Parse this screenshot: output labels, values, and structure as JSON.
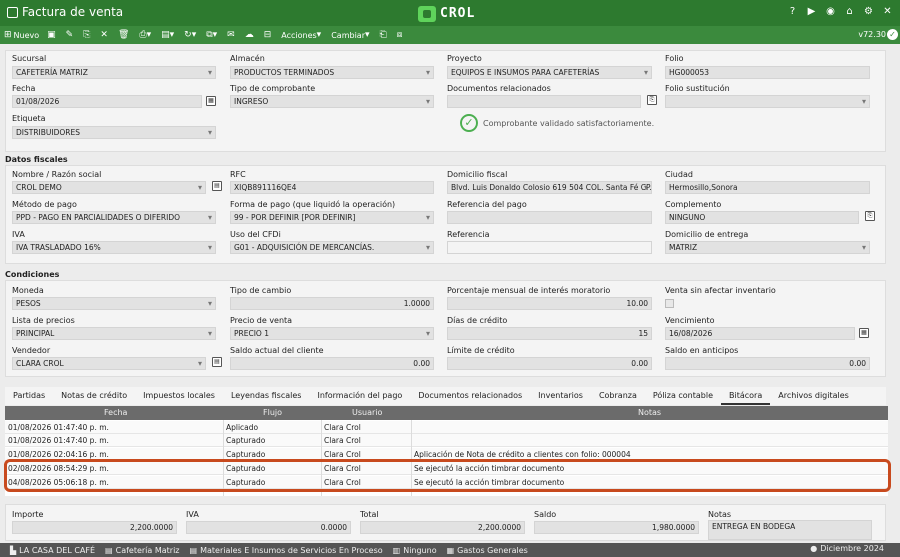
{
  "window": {
    "title": "Factura de venta",
    "logo_text": "CROL"
  },
  "toolbar": {
    "nuevo": "Nuevo",
    "acciones": "Acciones",
    "cambiar": "Cambiar",
    "version": "v72.30"
  },
  "general": {
    "sucursal": {
      "label": "Sucursal",
      "value": "CAFETERÍA MATRIZ"
    },
    "almacen": {
      "label": "Almacén",
      "value": "PRODUCTOS TERMINADOS"
    },
    "proyecto": {
      "label": "Proyecto",
      "value": "EQUIPOS E INSUMOS PARA CAFETERÍAS"
    },
    "folio": {
      "label": "Folio",
      "value": "HG000053"
    },
    "fecha": {
      "label": "Fecha",
      "value": "01/08/2026"
    },
    "tipo_comprobante": {
      "label": "Tipo de comprobante",
      "value": "INGRESO"
    },
    "documentos": {
      "label": "Documentos relacionados",
      "value": ""
    },
    "folio_sustitucion": {
      "label": "Folio sustitución",
      "value": ""
    },
    "etiqueta": {
      "label": "Etiqueta",
      "value": "DISTRIBUIDORES"
    },
    "validation": "Comprobante validado satisfactoriamente."
  },
  "fiscal": {
    "section": "Datos fiscales",
    "nombre": {
      "label": "Nombre / Razón social",
      "value": "CROL DEMO"
    },
    "rfc": {
      "label": "RFC",
      "value": "XIQB891116QE4"
    },
    "domicilio": {
      "label": "Domicilio fiscal",
      "value": "Blvd. Luis Donaldo Colosio 619 504 COL. Santa Fé CP.8"
    },
    "ciudad": {
      "label": "Ciudad",
      "value": "Hermosillo,Sonora"
    },
    "metodo": {
      "label": "Método de pago",
      "value": "PPD - PAGO EN PARCIALIDADES O DIFERIDO"
    },
    "forma": {
      "label": "Forma de pago (que liquidó la operación)",
      "value": "99 - POR DEFINIR [POR DEFINIR]"
    },
    "referencia_pago": {
      "label": "Referencia del pago",
      "value": ""
    },
    "complemento": {
      "label": "Complemento",
      "value": "NINGUNO"
    },
    "iva": {
      "label": "IVA",
      "value": "IVA TRASLADADO 16%"
    },
    "uso_cfdi": {
      "label": "Uso del CFDi",
      "value": "G01 - ADQUISICIÓN DE MERCANCÍAS."
    },
    "referencia": {
      "label": "Referencia",
      "value": ""
    },
    "domicilio_entrega": {
      "label": "Domicilio de entrega",
      "value": "MATRIZ"
    }
  },
  "condiciones": {
    "section": "Condiciones",
    "moneda": {
      "label": "Moneda",
      "value": "PESOS"
    },
    "tipo_cambio": {
      "label": "Tipo de cambio",
      "value": "1.0000"
    },
    "porcentaje": {
      "label": "Porcentaje mensual de interés moratorio",
      "value": "10.00"
    },
    "venta_sin": {
      "label": "Venta sin afectar inventario"
    },
    "lista": {
      "label": "Lista de precios",
      "value": "PRINCIPAL"
    },
    "precio": {
      "label": "Precio de venta",
      "value": "PRECIO 1"
    },
    "dias": {
      "label": "Días de crédito",
      "value": "15"
    },
    "vencimiento": {
      "label": "Vencimiento",
      "value": "16/08/2026"
    },
    "vendedor": {
      "label": "Vendedor",
      "value": "CLARA CROL"
    },
    "saldo_cliente": {
      "label": "Saldo actual del cliente",
      "value": "0.00"
    },
    "limite": {
      "label": "Límite de crédito",
      "value": "0.00"
    },
    "saldo_anticipos": {
      "label": "Saldo en anticipos",
      "value": "0.00"
    }
  },
  "tabs": [
    "Partidas",
    "Notas de crédito",
    "Impuestos locales",
    "Leyendas fiscales",
    "Información del pago",
    "Documentos relacionados",
    "Inventarios",
    "Cobranza",
    "Póliza contable",
    "Bitácora",
    "Archivos digitales"
  ],
  "grid": {
    "headers": [
      "Fecha",
      "Flujo",
      "Usuario",
      "Notas"
    ],
    "rows": [
      [
        "01/08/2026 01:47:40 p. m.",
        "Aplicado",
        "Clara Crol",
        ""
      ],
      [
        "01/08/2026 01:47:40 p. m.",
        "Capturado",
        "Clara Crol",
        ""
      ],
      [
        "01/08/2026 02:04:16 p. m.",
        "Capturado",
        "Clara Crol",
        "Aplicación de Nota de crédito a clientes con folio: 000004"
      ],
      [
        "02/08/2026 08:54:29 p. m.",
        "Capturado",
        "Clara Crol",
        "Se ejecutó la acción timbrar documento"
      ],
      [
        "04/08/2026 05:06:18 p. m.",
        "Capturado",
        "Clara Crol",
        "Se ejecutó la acción timbrar documento"
      ]
    ]
  },
  "totals": {
    "importe": {
      "label": "Importe",
      "value": "2,200.0000"
    },
    "iva": {
      "label": "IVA",
      "value": "0.0000"
    },
    "total": {
      "label": "Total",
      "value": "2,200.0000"
    },
    "saldo": {
      "label": "Saldo",
      "value": "1,980.0000"
    },
    "notas": {
      "label": "Notas",
      "value": "ENTREGA EN BODEGA"
    }
  },
  "statusbar": {
    "items": [
      "LA CASA DEL CAFÉ",
      "Cafetería Matriz",
      "Materiales E Insumos de Servicios En Proceso",
      "Ninguno",
      "Gastos Generales"
    ],
    "date": "Diciembre 2024"
  },
  "colors": {
    "titlebar": "#2d7a2f",
    "toolbar": "#3b8a3d",
    "highlight": "#c84a1e"
  }
}
